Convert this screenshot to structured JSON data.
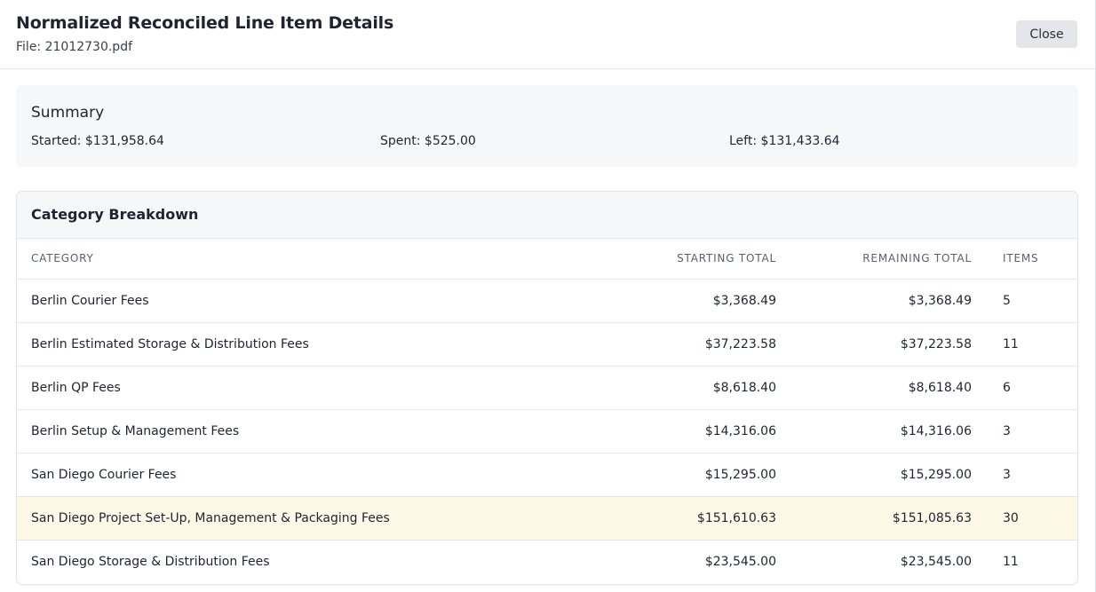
{
  "header": {
    "title": "Normalized Reconciled Line Item Details",
    "file_label": "File: 21012730.pdf",
    "close_label": "Close"
  },
  "summary": {
    "title": "Summary",
    "started": "Started: $131,958.64",
    "spent": "Spent: $525.00",
    "left": "Left: $131,433.64"
  },
  "breakdown": {
    "title": "Category Breakdown",
    "columns": {
      "category": "CATEGORY",
      "starting_total": "STARTING TOTAL",
      "remaining_total": "REMAINING TOTAL",
      "items": "ITEMS"
    },
    "rows": [
      {
        "category": "Berlin Courier Fees",
        "starting_total": "$3,368.49",
        "remaining_total": "$3,368.49",
        "items": "5",
        "highlighted": false
      },
      {
        "category": "Berlin Estimated Storage & Distribution Fees",
        "starting_total": "$37,223.58",
        "remaining_total": "$37,223.58",
        "items": "11",
        "highlighted": false
      },
      {
        "category": "Berlin QP Fees",
        "starting_total": "$8,618.40",
        "remaining_total": "$8,618.40",
        "items": "6",
        "highlighted": false
      },
      {
        "category": "Berlin Setup & Management Fees",
        "starting_total": "$14,316.06",
        "remaining_total": "$14,316.06",
        "items": "3",
        "highlighted": false
      },
      {
        "category": "San Diego Courier Fees",
        "starting_total": "$15,295.00",
        "remaining_total": "$15,295.00",
        "items": "3",
        "highlighted": false
      },
      {
        "category": "San Diego Project Set-Up, Management & Packaging Fees",
        "starting_total": "$151,610.63",
        "remaining_total": "$151,085.63",
        "items": "30",
        "highlighted": true
      },
      {
        "category": "San Diego Storage & Distribution Fees",
        "starting_total": "$23,545.00",
        "remaining_total": "$23,545.00",
        "items": "11",
        "highlighted": false
      }
    ]
  },
  "colors": {
    "highlight_row": "#fef9e6",
    "card_background": "#f6f7f9",
    "close_button": "#e5e6e9"
  }
}
